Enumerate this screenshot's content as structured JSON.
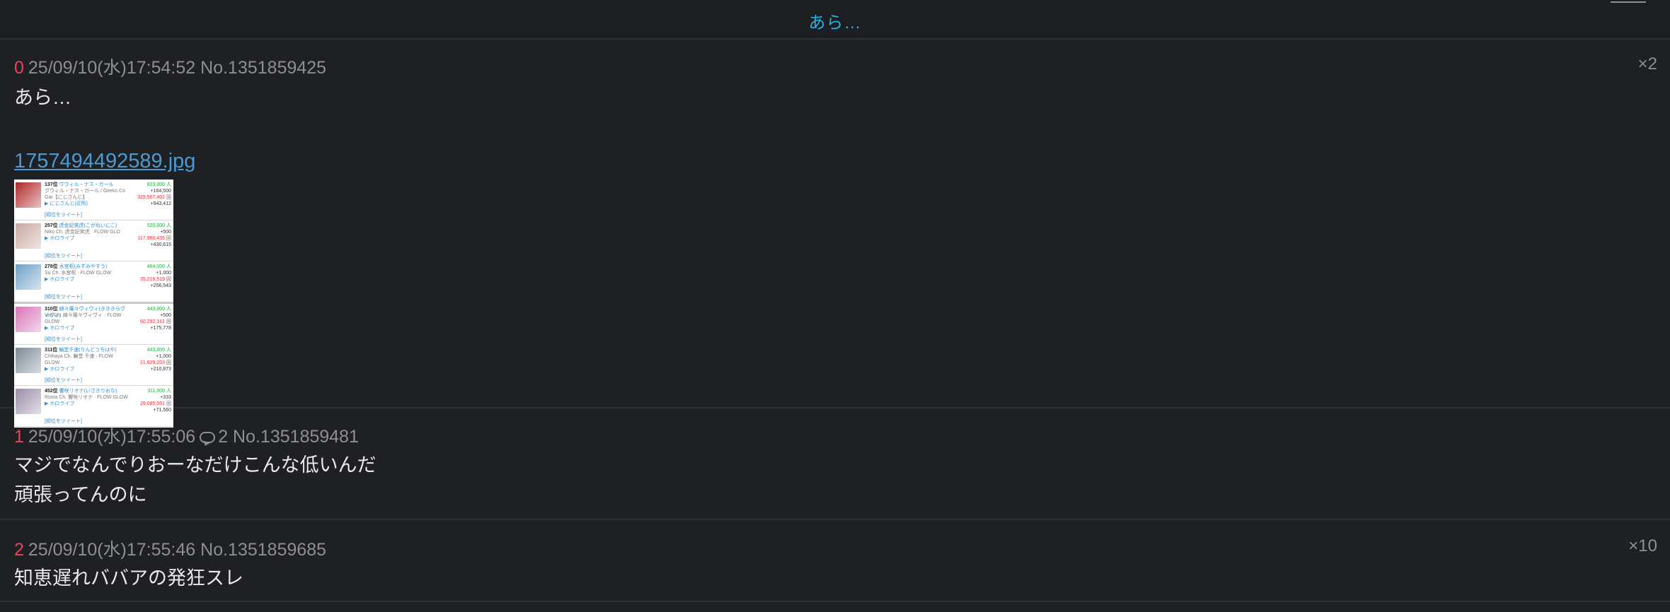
{
  "thread_title": "あら…",
  "posts": [
    {
      "num": "0",
      "datetime": "25/09/10(水)17:54:52",
      "no": "No.1351859425",
      "multiplier": "×2",
      "lines": [
        "あら…"
      ],
      "file": "1757494492589.jpg"
    },
    {
      "num": "1",
      "datetime": "25/09/10(水)17:55:06",
      "replies": "2",
      "no": "No.1351859481",
      "lines": [
        "マジでなんでりおーなだけこんな低いんだ",
        "頑張ってんのに"
      ]
    },
    {
      "num": "2",
      "datetime": "25/09/10(水)17:55:46",
      "no": "No.1351859685",
      "multiplier": "×10",
      "lines": [
        "知恵遅れババアの発狂スレ"
      ]
    }
  ],
  "thumbnail_rows": [
    {
      "rank": "137位",
      "name": "ヴウィル・ナス・ガール",
      "sub": "グウィル・ナス・ガール / Geeks Co Gar【にじさんじ】",
      "group": "にじさんじ(近所)",
      "tweet": "[順位をツイート]",
      "subs": "823,000 人",
      "delta1": "+164,500",
      "views": "329,567,402 回",
      "delta2": "+943,412",
      "avatar": "#b02828"
    },
    {
      "rank": "257位",
      "name": "虎金妃笑虎(こがねいにこ)",
      "sub": "Niko Ch. 虎金妃笑虎 · FLOW GLO",
      "group": "ホロライブ",
      "tweet": "[順位をツイート]",
      "subs": "520,000 人",
      "delta1": "+500",
      "views": "117,960,435 回",
      "delta2": "+430,615",
      "avatar": "#c9a7a0"
    },
    {
      "rank": "278位",
      "name": "水宮枢(みずみやすう)",
      "sub": "Su Ch. 水宮枢 · FLOW GLOW",
      "group": "ホロライブ",
      "tweet": "[順位をツイート]",
      "subs": "464,000 人",
      "delta1": "+1,000",
      "views": "35,216,519 回",
      "delta2": "+256,543",
      "avatar": "#6fa0c8"
    },
    {
      "rank": "310位",
      "name": "綺々羅々ヴィヴィ(きききらヴィヴィ)",
      "sub": "Vivi Ch. 綺々羅々ヴィヴィ · FLOW GLOW",
      "group": "ホロライブ",
      "tweet": "[順位をツイート]",
      "subs": "443,000 人",
      "delta1": "+500",
      "views": "60,292,161 回",
      "delta2": "+175,778",
      "avatar": "#d874b8"
    },
    {
      "rank": "311位",
      "name": "輪堂千速(りんどうちはや)",
      "sub": "Chihaya Ch. 輪堂 千速 · FLOW GLOW",
      "group": "ホロライブ",
      "tweet": "[順位をツイート]",
      "subs": "443,000 人",
      "delta1": "+1,000",
      "views": "21,629,203 回",
      "delta2": "+210,873",
      "avatar": "#7d8a96"
    },
    {
      "rank": "452位",
      "name": "響咲リオナ(いさきりおな)",
      "sub": "Riona Ch. 響咲リオナ · FLOW GLOW",
      "group": "ホロライブ",
      "tweet": "[順位をツイート]",
      "subs": "311,000 人",
      "delta1": "+333",
      "views": "29,085,551 回",
      "delta2": "+71,560",
      "avatar": "#9b8ea8"
    }
  ]
}
